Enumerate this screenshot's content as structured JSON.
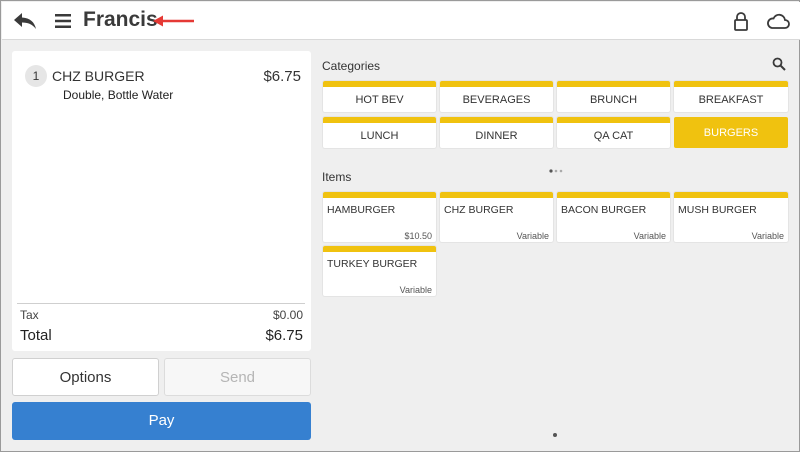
{
  "header": {
    "title": "Francis",
    "icons": {
      "back": "back-arrow-icon",
      "menu": "hamburger-menu-icon",
      "lock": "lock-icon",
      "cloud": "cloud-icon"
    },
    "annotation_color": "#e53935"
  },
  "order": {
    "items": [
      {
        "qty": "1",
        "name": "CHZ BURGER",
        "price": "$6.75",
        "modifiers": "Double, Bottle Water"
      }
    ],
    "tax_label": "Tax",
    "tax_value": "$0.00",
    "total_label": "Total",
    "total_value": "$6.75"
  },
  "actions": {
    "options_label": "Options",
    "send_label": "Send",
    "pay_label": "Pay",
    "pay_color": "#3680d0"
  },
  "categories": {
    "heading": "Categories",
    "accent_color": "#f0c20f",
    "items": [
      "HOT BEV",
      "BEVERAGES",
      "BRUNCH",
      "BREAKFAST",
      "LUNCH",
      "DINNER",
      "QA CAT",
      "BURGERS"
    ],
    "selected": "BURGERS"
  },
  "menu_items": {
    "heading": "Items",
    "items": [
      {
        "name": "HAMBURGER",
        "price": "$10.50"
      },
      {
        "name": "CHZ BURGER",
        "price": "Variable"
      },
      {
        "name": "BACON BURGER",
        "price": "Variable"
      },
      {
        "name": "MUSH BURGER",
        "price": "Variable"
      },
      {
        "name": "TURKEY BURGER",
        "price": "Variable"
      }
    ]
  }
}
